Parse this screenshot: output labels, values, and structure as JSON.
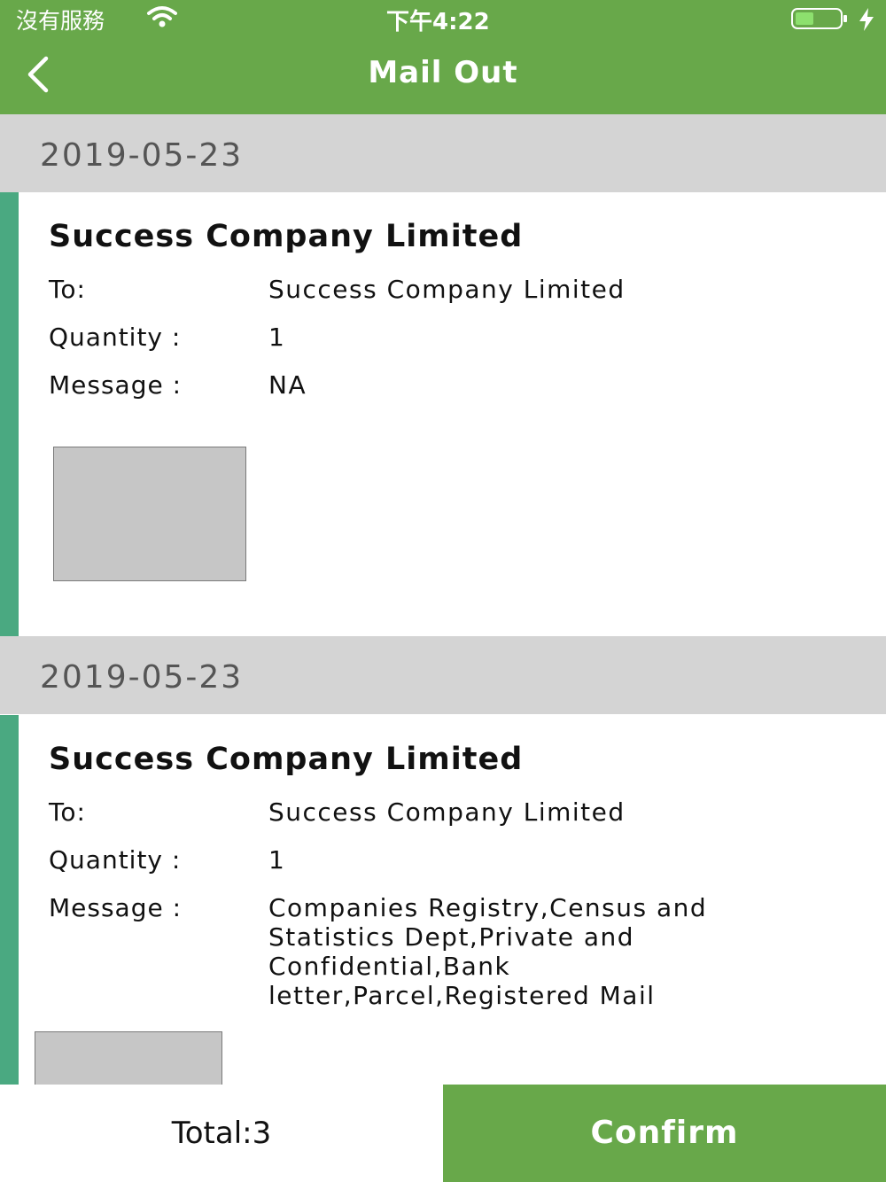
{
  "status_bar": {
    "carrier": "沒有服務",
    "time": "下午4:22"
  },
  "header": {
    "title": "Mail Out"
  },
  "records": [
    {
      "date": "2019-05-23",
      "company": "Success Company Limited",
      "to_label": "To:",
      "to": "Success Company Limited",
      "quantity_label": "Quantity :",
      "quantity": "1",
      "message_label": "Message :",
      "message": "NA"
    },
    {
      "date": "2019-05-23",
      "company": "Success Company Limited",
      "to_label": "To:",
      "to": "Success Company Limited",
      "quantity_label": "Quantity :",
      "quantity": "1",
      "message_label": "Message :",
      "message": "Companies Registry,Census and Statistics Dept,Private and Confidential,Bank letter,Parcel,Registered Mail"
    }
  ],
  "footer": {
    "total": "Total:3",
    "confirm_label": "Confirm"
  },
  "colors": {
    "header": "#68a84a",
    "accent": "#4aa981",
    "date_bar": "#d4d4d4"
  },
  "icons": {
    "back": "chevron-left-icon",
    "wifi": "wifi-icon",
    "battery": "battery-icon",
    "charging": "bolt-icon"
  }
}
